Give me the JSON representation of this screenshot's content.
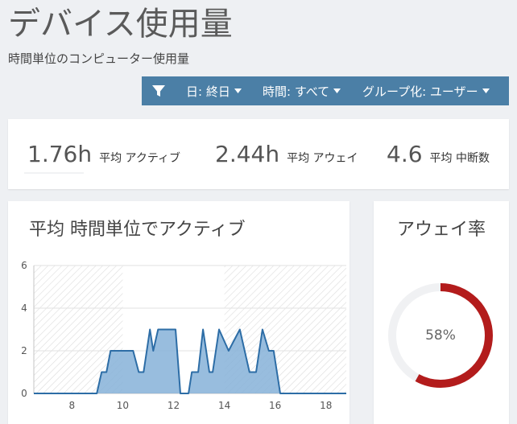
{
  "page": {
    "title": "デバイス使用量",
    "subtitle": "時間単位のコンピューター使用量"
  },
  "filters": {
    "background": "#4b7fa6",
    "icon": "filter-icon",
    "items": [
      {
        "label": "日: 終日",
        "icon": "chevron-down-icon"
      },
      {
        "label": "時間: すべて",
        "icon": "chevron-down-icon"
      },
      {
        "label": "グループ化: ユーザー",
        "icon": "chevron-down-icon"
      }
    ]
  },
  "stats": [
    {
      "value": "1.76h",
      "label": "平均 アクティブ"
    },
    {
      "value": "2.44h",
      "label": "平均 アウェイ"
    },
    {
      "value": "4.6",
      "label": "平均 中断数"
    }
  ],
  "away_rate": {
    "title": "アウェイ率",
    "value": 58,
    "label": "58%",
    "color": "#b31c1c",
    "track_color": "#f0f1f3"
  },
  "chart_data": {
    "type": "area",
    "title": "平均 時間単位でアクティブ",
    "xlim": [
      6.5,
      18.8
    ],
    "ylim": [
      0,
      6
    ],
    "x_ticks": [
      8,
      10,
      12,
      14,
      16,
      18
    ],
    "y_ticks": [
      0,
      2,
      4,
      6
    ],
    "grid": true,
    "shaded_ranges": [
      [
        6.5,
        10
      ],
      [
        14,
        18.8
      ]
    ],
    "colors": {
      "line": "#2d6da6",
      "fill": "#86b1d8",
      "hatch": "#dcdcdc"
    },
    "series": [
      {
        "points": [
          [
            6.5,
            0
          ],
          [
            8.98,
            0
          ],
          [
            9.17,
            1
          ],
          [
            9.36,
            1
          ],
          [
            9.52,
            2
          ],
          [
            10.41,
            2
          ],
          [
            10.63,
            1
          ],
          [
            10.82,
            1
          ],
          [
            11.07,
            3
          ],
          [
            11.2,
            2
          ],
          [
            11.39,
            3
          ],
          [
            12.08,
            3
          ],
          [
            12.27,
            0
          ],
          [
            12.59,
            0
          ],
          [
            12.72,
            1
          ],
          [
            12.97,
            1
          ],
          [
            13.16,
            3
          ],
          [
            13.41,
            1
          ],
          [
            13.54,
            1
          ],
          [
            13.79,
            3
          ],
          [
            14.17,
            2
          ],
          [
            14.61,
            3
          ],
          [
            14.99,
            1
          ],
          [
            15.25,
            1
          ],
          [
            15.5,
            3
          ],
          [
            15.75,
            2
          ],
          [
            15.94,
            2
          ],
          [
            16.2,
            0
          ],
          [
            18.8,
            0
          ]
        ]
      }
    ]
  }
}
